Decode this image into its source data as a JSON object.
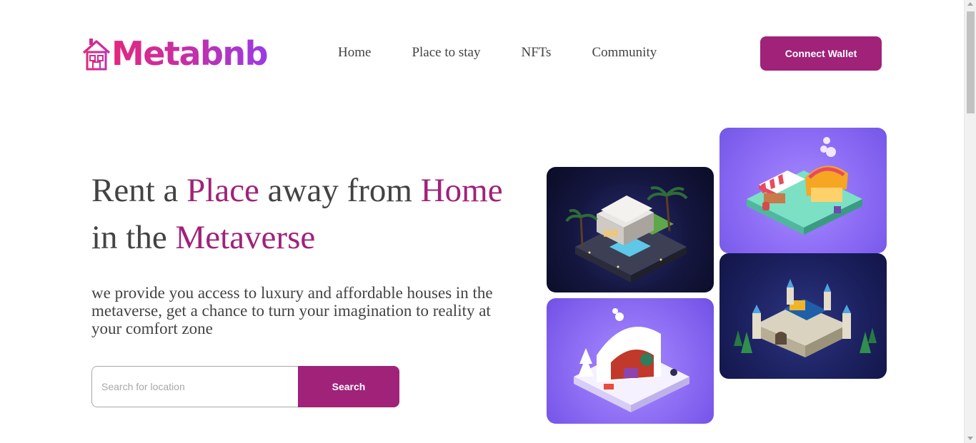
{
  "brand": {
    "name": "Metabnb",
    "icon": "house-icon"
  },
  "nav": {
    "items": [
      {
        "label": "Home"
      },
      {
        "label": "Place to stay"
      },
      {
        "label": "NFTs"
      },
      {
        "label": "Community"
      }
    ]
  },
  "header": {
    "connect_label": "Connect Wallet"
  },
  "hero": {
    "line1_part1": "Rent a ",
    "line1_accent1": "Place",
    "line1_part2": " away from ",
    "line1_accent2": "Home",
    "line2_part1": "in the ",
    "line2_accent": "Metaverse",
    "subtext": "we provide you access to luxury and affordable houses in the metaverse, get a chance to turn your imagination to reality at your comfort zone"
  },
  "search": {
    "placeholder": "Search for location",
    "button_label": "Search"
  },
  "colors": {
    "accent": "#a02279",
    "text": "#434343",
    "logo_gradient_start": "#e2277e",
    "logo_gradient_end": "#9a3be6"
  },
  "images": [
    {
      "name": "villa-image"
    },
    {
      "name": "market-image"
    },
    {
      "name": "snow-cabin-image"
    },
    {
      "name": "castle-image"
    }
  ]
}
